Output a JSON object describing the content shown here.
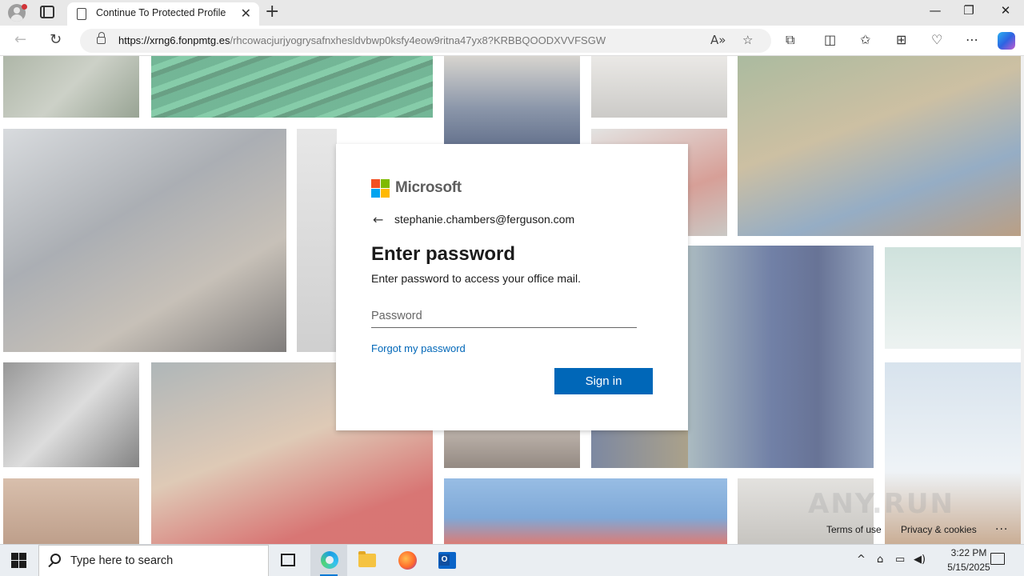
{
  "browser": {
    "tab_title": "Continue To Protected Profile",
    "tab_close": "✕",
    "new_tab": "+",
    "url_host": "https://xrng6.fonpmtg.es",
    "url_path": "/rhcowacjurjyogrysafnxhesldvbwp0ksfy4eow9ritna47yx8?KRBBQOODXVVFSGW",
    "window_minimize": "—",
    "window_restore": "❐",
    "window_close": "✕"
  },
  "login": {
    "brand": "Microsoft",
    "back_arrow": "←",
    "email": "stephanie.chambers@ferguson.com",
    "heading": "Enter password",
    "subtext": "Enter password to access your office mail.",
    "password_placeholder": "Password",
    "password_value": "",
    "forgot_label": "Forgot my password",
    "signin_label": "Sign in",
    "logo_colors": [
      "#f25022",
      "#7fba00",
      "#00a4ef",
      "#ffb900"
    ],
    "accent_color": "#0067b8"
  },
  "footer": {
    "terms": "Terms of use",
    "privacy": "Privacy & cookies",
    "more": "..."
  },
  "taskbar": {
    "search_placeholder": "Type here to search",
    "time": "3:22 PM",
    "date": "5/15/2025",
    "tray_chevron": "^"
  }
}
